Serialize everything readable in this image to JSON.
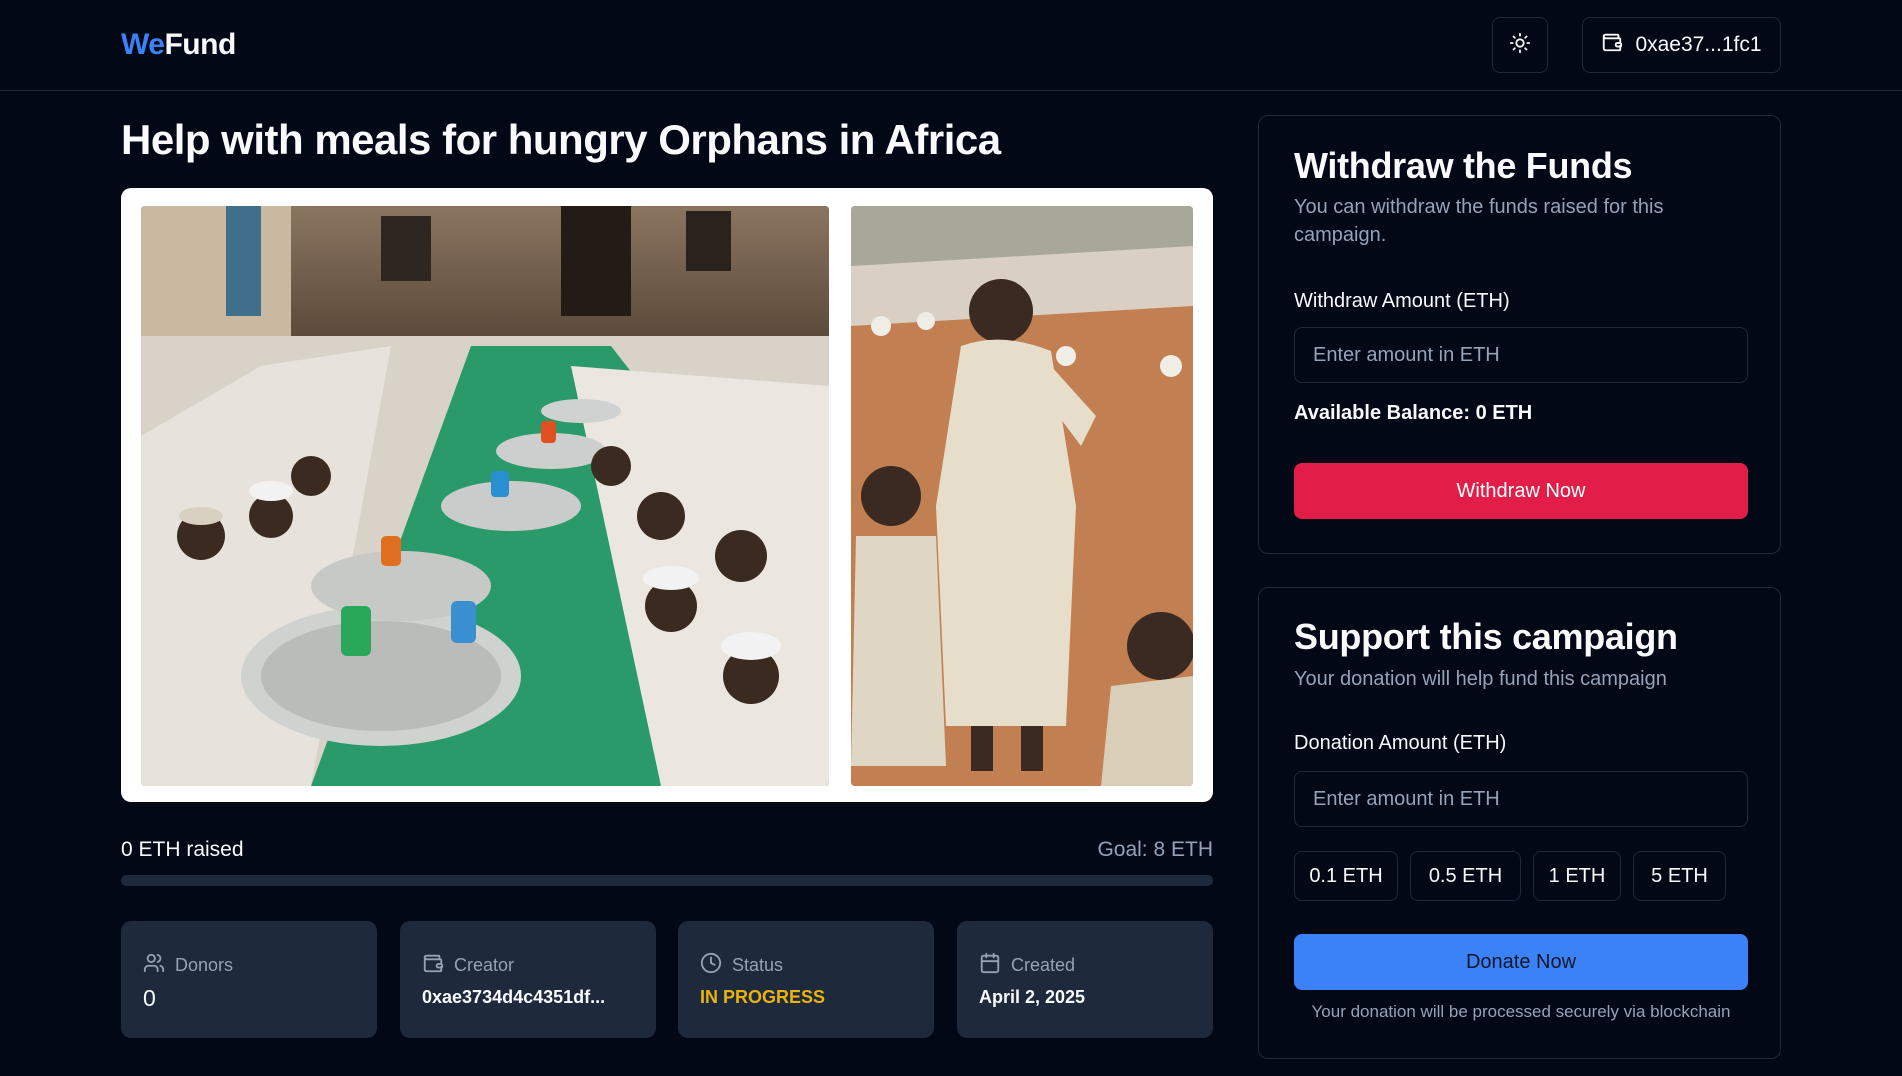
{
  "header": {
    "logo_we": "We",
    "logo_fund": "Fund",
    "theme_icon": "sun-icon",
    "wallet_icon": "wallet-icon",
    "wallet_address": "0xae37...1fc1"
  },
  "campaign": {
    "title": "Help with meals for hungry Orphans in Africa",
    "raised": "0 ETH raised",
    "goal": "Goal: 8 ETH",
    "progress_fraction": 0,
    "stats": {
      "donors_label": "Donors",
      "donors_value": "0",
      "creator_label": "Creator",
      "creator_value": "0xae3734d4c4351df...",
      "status_label": "Status",
      "status_value": "IN PROGRESS",
      "created_label": "Created",
      "created_value": "April 2, 2025"
    }
  },
  "withdraw": {
    "title": "Withdraw the Funds",
    "subtitle": "You can withdraw the funds raised for this campaign.",
    "amount_label": "Withdraw Amount (ETH)",
    "amount_placeholder": "Enter amount in ETH",
    "balance": "Available Balance: 0 ETH",
    "button": "Withdraw Now"
  },
  "donate": {
    "title": "Support this campaign",
    "subtitle": "Your donation will help fund this campaign",
    "amount_label": "Donation Amount (ETH)",
    "amount_placeholder": "Enter amount in ETH",
    "quick_amounts": [
      "0.1 ETH",
      "0.5 ETH",
      "1 ETH",
      "5 ETH"
    ],
    "button": "Donate Now",
    "note": "Your donation will be processed securely via blockchain"
  },
  "colors": {
    "background": "#030817",
    "accent_blue": "#3b82f6",
    "withdraw_red": "#e11d48",
    "status_yellow": "#eab308",
    "card_border": "#1e293b"
  }
}
